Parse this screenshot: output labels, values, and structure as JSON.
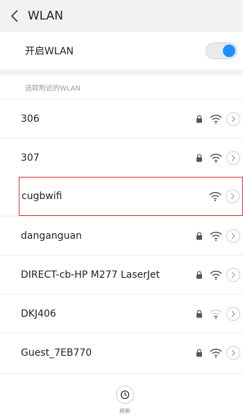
{
  "header": {
    "title": "WLAN"
  },
  "toggle": {
    "label": "开启WLAN",
    "on": true,
    "accent": "#1e90ff"
  },
  "section": {
    "label": "选取附近的WLAN"
  },
  "networks": [
    {
      "name": "306",
      "locked": true,
      "highlighted": false
    },
    {
      "name": "307",
      "locked": true,
      "highlighted": false
    },
    {
      "name": "cugbwifi",
      "locked": false,
      "highlighted": true
    },
    {
      "name": "danganguan",
      "locked": true,
      "highlighted": false
    },
    {
      "name": "DIRECT-cb-HP M277 LaserJet",
      "locked": true,
      "highlighted": false
    },
    {
      "name": "DKJ406",
      "locked": true,
      "highlighted": false
    },
    {
      "name": "Guest_7EB770",
      "locked": true,
      "highlighted": false
    }
  ],
  "bottom": {
    "refresh_label": "刷新"
  },
  "colors": {
    "highlight_border": "#d9302f",
    "header_bg": "#f2f2f2"
  }
}
